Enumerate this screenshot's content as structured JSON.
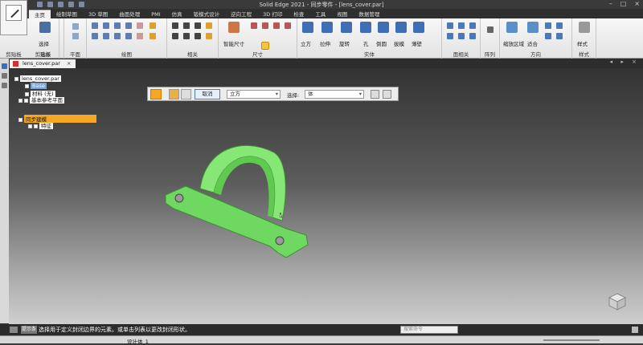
{
  "window": {
    "title": "Solid Edge 2021 - 同步零件 - [lens_cover.par]"
  },
  "ribbon": {
    "tabs": [
      "主页",
      "绘制草图",
      "3D 草图",
      "曲面处理",
      "PMI",
      "仿真",
      "钣模式设计",
      "逆向工程",
      "3D 打印",
      "检查",
      "工具",
      "视图",
      "数据管理"
    ],
    "active_tab": "主页",
    "groups": [
      "剪贴板",
      "选择",
      "平面",
      "绘图",
      "相关",
      "尺寸",
      "实体",
      "面相关",
      "阵列",
      "方向",
      "样式"
    ],
    "buttons": {
      "select": "选择",
      "smart_dimension": "智能尺寸",
      "extrude": "立方",
      "pull": "拉伸",
      "revolve": "旋转",
      "hole": "孔",
      "round": "倒圆",
      "draft": "拔模",
      "thin": "薄壁",
      "zoom_area": "缩放区域",
      "fit": "适合",
      "style": "样式"
    }
  },
  "document": {
    "tab_label": "lens_cover.par",
    "close_glyph": "×",
    "nav_glyphs": "◂ ▸ ×"
  },
  "pathfinder": {
    "root": "lens_cover.par",
    "items": [
      "Base",
      "材料 (无)",
      "基本参考平面"
    ],
    "sync_label": "同步建模",
    "feature_label": "特征"
  },
  "command_bar": {
    "cancel_label": "取消",
    "shape_value": "立方",
    "select_label": "选择:",
    "select_value": "体"
  },
  "status": {
    "prompt_label": "提示条",
    "prompt_text": "选择用于定义封闭边界的元素。或单击列表以更改封闭形状。",
    "search_placeholder": "搜索命令",
    "body_label": "设计体_1"
  },
  "colors": {
    "part_green": "#7fe06f",
    "highlight_orange": "#f5a623"
  }
}
